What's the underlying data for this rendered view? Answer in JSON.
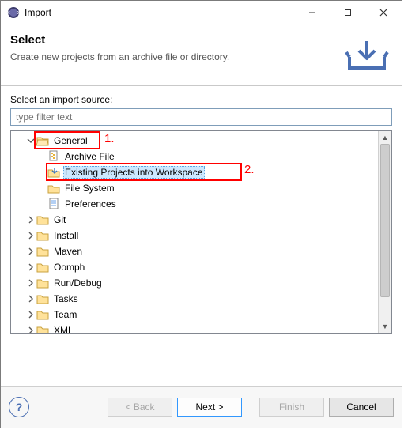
{
  "window": {
    "title": "Import"
  },
  "header": {
    "title": "Select",
    "description": "Create new projects from an archive file or directory."
  },
  "body": {
    "label": "Select an import source:",
    "filter_placeholder": "type filter text"
  },
  "tree": {
    "general": {
      "label": "General"
    },
    "general_children": {
      "archive": "Archive File",
      "existing": "Existing Projects into Workspace",
      "filesystem": "File System",
      "preferences": "Preferences"
    },
    "git": {
      "label": "Git"
    },
    "install": {
      "label": "Install"
    },
    "maven": {
      "label": "Maven"
    },
    "oomph": {
      "label": "Oomph"
    },
    "rundebug": {
      "label": "Run/Debug"
    },
    "tasks": {
      "label": "Tasks"
    },
    "team": {
      "label": "Team"
    },
    "xml": {
      "label": "XML"
    }
  },
  "annotations": {
    "one": "1.",
    "two": "2."
  },
  "footer": {
    "back": "< Back",
    "next": "Next >",
    "finish": "Finish",
    "cancel": "Cancel"
  }
}
